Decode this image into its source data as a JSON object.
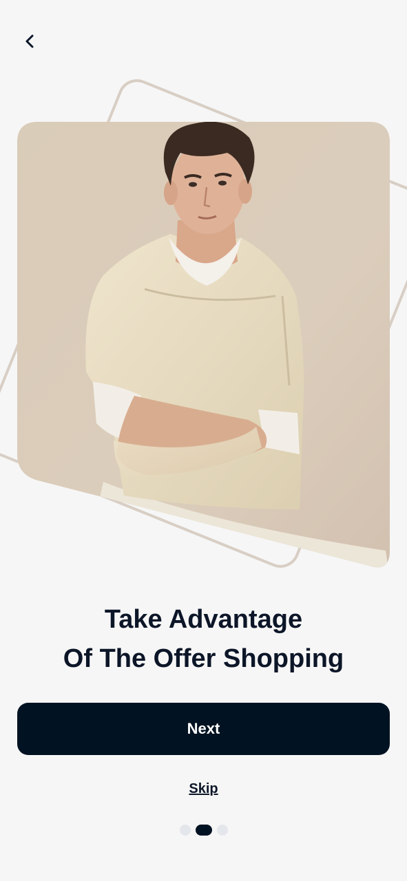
{
  "nav": {
    "back_icon": "chevron-left-icon"
  },
  "hero": {
    "image": "photo of man in beige short-sleeve sweater with arms crossed"
  },
  "onboarding": {
    "title_line1": "Take Advantage",
    "title_line2": "Of The Offer Shopping",
    "next_label": "Next",
    "skip_label": "Skip",
    "page_current": 2,
    "page_total": 3
  },
  "colors": {
    "background": "#f6f6f6",
    "primary": "#011222",
    "text": "#0c1628",
    "dot_inactive": "#e3e6ea",
    "frame_outline": "#d8cec4"
  }
}
